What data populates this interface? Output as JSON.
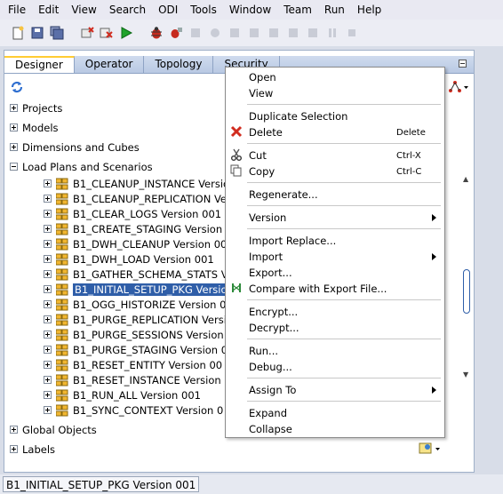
{
  "menubar": [
    "File",
    "Edit",
    "View",
    "Search",
    "ODI",
    "Tools",
    "Window",
    "Team",
    "Run",
    "Help"
  ],
  "toolbar": {
    "icons": [
      "new-icon",
      "save-icon",
      "save-all-icon",
      "debug-icon",
      "delete-icon",
      "run-icon",
      "bug-icon",
      "debug-step-icon",
      "disabled-icon"
    ]
  },
  "tabs": [
    "Designer",
    "Operator",
    "Topology",
    "Security"
  ],
  "tree": {
    "accordions_top": [
      "Projects",
      "Models",
      "Dimensions and Cubes",
      "Load Plans and Scenarios"
    ],
    "scenarios": [
      "B1_CLEANUP_INSTANCE Version",
      "B1_CLEANUP_REPLICATION Ve",
      "B1_CLEAR_LOGS Version 001",
      "B1_CREATE_STAGING Version",
      "B1_DWH_CLEANUP Version 00",
      "B1_DWH_LOAD Version 001",
      "B1_GATHER_SCHEMA_STATS V",
      "B1_INITIAL_SETUP_PKG Versio",
      "B1_OGG_HISTORIZE Version 0",
      "B1_PURGE_REPLICATION Versi",
      "B1_PURGE_SESSIONS Version",
      "B1_PURGE_STAGING Version 0",
      "B1_RESET_ENTITY Version 00",
      "B1_RESET_INSTANCE Version",
      "B1_RUN_ALL Version 001",
      "B1_SYNC_CONTEXT Version 0"
    ],
    "accordions_bottom": [
      "Global Objects",
      "Labels"
    ]
  },
  "context_menu": {
    "open": "Open",
    "view": "View",
    "duplicate_selection": "Duplicate Selection",
    "delete": "Delete",
    "delete_shortcut": "Delete",
    "cut": "Cut",
    "cut_shortcut": "Ctrl-X",
    "copy": "Copy",
    "copy_shortcut": "Ctrl-C",
    "regenerate": "Regenerate...",
    "version": "Version",
    "import_replace": "Import Replace...",
    "import": "Import",
    "export": "Export...",
    "compare": "Compare with Export File...",
    "encrypt": "Encrypt...",
    "decrypt": "Decrypt...",
    "run": "Run...",
    "debug": "Debug...",
    "assign_to": "Assign To",
    "expand": "Expand",
    "collapse": "Collapse"
  },
  "status_bar": {
    "text": "B1_INITIAL_SETUP_PKG Version 001"
  },
  "colors": {
    "selection": "#2f5ea8",
    "tab_highlight": "#ffcc33",
    "delete_red": "#d12c1f",
    "run_green": "#1fa32b"
  }
}
